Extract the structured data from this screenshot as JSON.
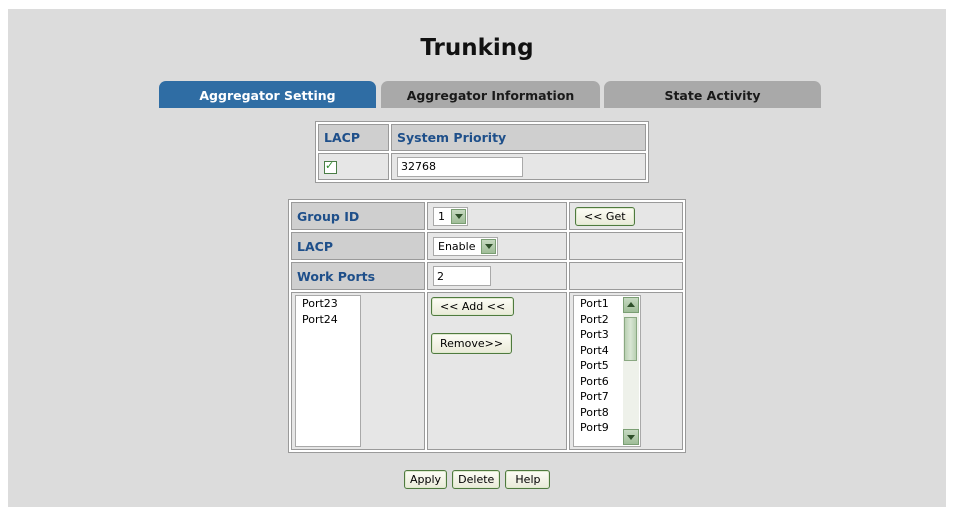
{
  "page": {
    "title": "Trunking"
  },
  "tabs": [
    {
      "label": "Aggregator Setting",
      "active": true
    },
    {
      "label": "Aggregator Information",
      "active": false
    },
    {
      "label": "State Activity",
      "active": false
    }
  ],
  "lacp_system": {
    "lacp_header": "LACP",
    "priority_header": "System Priority",
    "lacp_checked": true,
    "priority_value": "32768"
  },
  "group": {
    "group_id_label": "Group ID",
    "group_id_value": "1",
    "get_button": "<< Get",
    "lacp_label": "LACP",
    "lacp_value": "Enable",
    "work_ports_label": "Work Ports",
    "work_ports_value": "2",
    "selected_ports": [
      "Port23",
      "Port24"
    ],
    "add_button": "<< Add <<",
    "remove_button": "Remove>>",
    "available_ports": [
      "Port1",
      "Port2",
      "Port3",
      "Port4",
      "Port5",
      "Port6",
      "Port7",
      "Port8",
      "Port9"
    ]
  },
  "actions": {
    "apply": "Apply",
    "delete": "Delete",
    "help": "Help"
  },
  "colors": {
    "accent": "#2f6da4",
    "header_text": "#1e4f8a",
    "button_border": "#4f7a3e",
    "panel": "#dcdcdc"
  }
}
